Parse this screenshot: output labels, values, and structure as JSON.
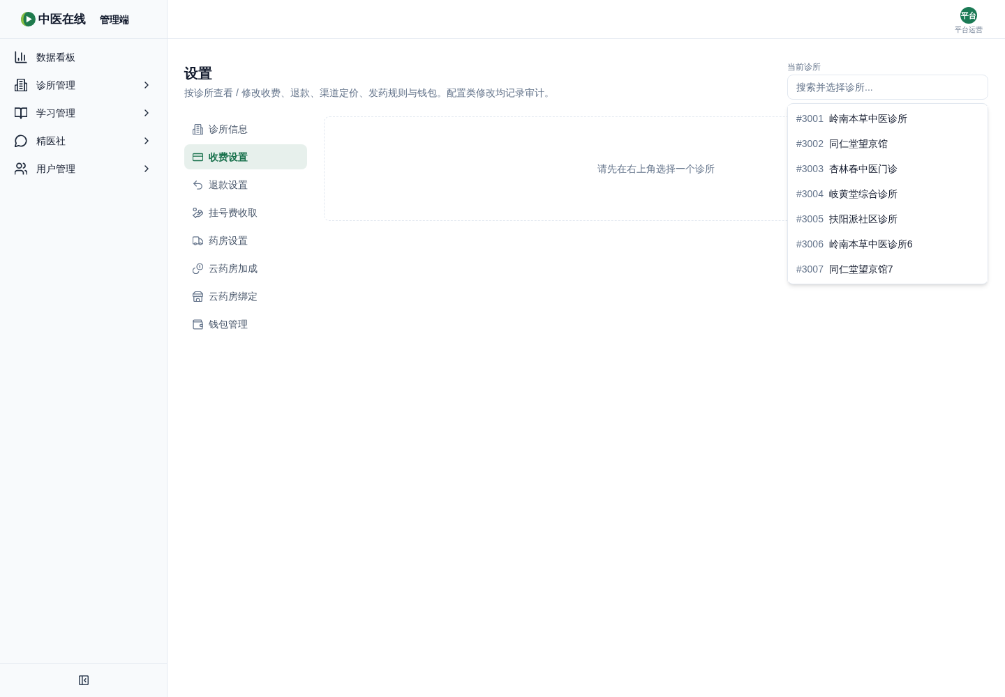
{
  "sidebar": {
    "brand": {
      "name": "中医在线",
      "edition": "管理端"
    },
    "items": [
      {
        "label": "数据看板",
        "expandable": false
      },
      {
        "label": "诊所管理",
        "expandable": true
      },
      {
        "label": "学习管理",
        "expandable": true
      },
      {
        "label": "精医社",
        "expandable": true
      },
      {
        "label": "用户管理",
        "expandable": true
      }
    ]
  },
  "header": {
    "user": {
      "avatar": "平台",
      "role": "平台运营"
    }
  },
  "page": {
    "title": "设置",
    "subtitle": "按诊所查看 / 修改收费、退款、渠道定价、发药规则与钱包。配置类修改均记录审计。"
  },
  "clinic_picker": {
    "label": "当前诊所",
    "placeholder": "搜索并选择诊所...",
    "expanded": true,
    "options": [
      {
        "id": "#3001",
        "name": "岭南本草中医诊所",
        "selected": false
      },
      {
        "id": "#3002",
        "name": "同仁堂望京馆",
        "selected": false
      },
      {
        "id": "#3003",
        "name": "杏林春中医门诊",
        "selected": false
      },
      {
        "id": "#3004",
        "name": "岐黄堂综合诊所",
        "selected": false
      },
      {
        "id": "#3005",
        "name": "扶阳派社区诊所",
        "selected": false
      },
      {
        "id": "#3006",
        "name": "岭南本草中医诊所6",
        "selected": false
      },
      {
        "id": "#3007",
        "name": "同仁堂望京馆7",
        "selected": false
      }
    ]
  },
  "settings_nav": {
    "items": [
      {
        "label": "诊所信息",
        "selected": false
      },
      {
        "label": "收费设置",
        "selected": true
      },
      {
        "label": "退款设置",
        "selected": false
      },
      {
        "label": "挂号费收取",
        "selected": false
      },
      {
        "label": "药房设置",
        "selected": false
      },
      {
        "label": "云药房加成",
        "selected": false
      },
      {
        "label": "云药房绑定",
        "selected": false
      },
      {
        "label": "钱包管理",
        "selected": false
      }
    ]
  },
  "content": {
    "empty_message": "请先在右上角选择一个诊所"
  }
}
